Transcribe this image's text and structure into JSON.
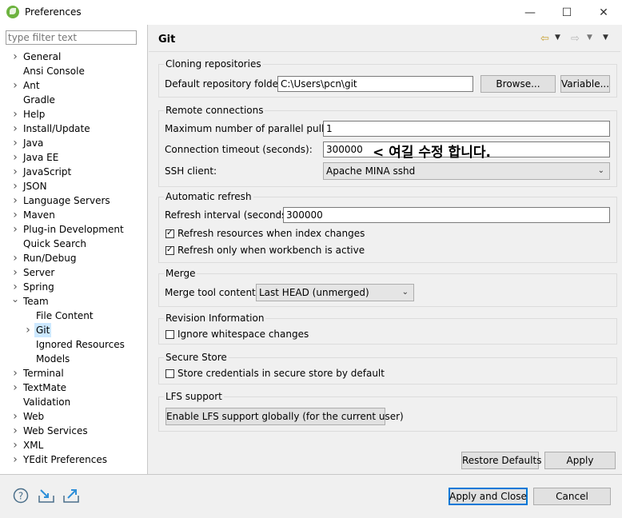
{
  "window": {
    "title": "Preferences",
    "controls": [
      "—",
      "☐",
      "✕"
    ]
  },
  "filter": {
    "placeholder": "type filter text"
  },
  "tree": [
    {
      "label": "General",
      "expander": "collapsed"
    },
    {
      "label": "Ansi Console",
      "expander": "none"
    },
    {
      "label": "Ant",
      "expander": "collapsed"
    },
    {
      "label": "Gradle",
      "expander": "none"
    },
    {
      "label": "Help",
      "expander": "collapsed"
    },
    {
      "label": "Install/Update",
      "expander": "collapsed"
    },
    {
      "label": "Java",
      "expander": "collapsed"
    },
    {
      "label": "Java EE",
      "expander": "collapsed"
    },
    {
      "label": "JavaScript",
      "expander": "collapsed"
    },
    {
      "label": "JSON",
      "expander": "collapsed"
    },
    {
      "label": "Language Servers",
      "expander": "collapsed"
    },
    {
      "label": "Maven",
      "expander": "collapsed"
    },
    {
      "label": "Plug-in Development",
      "expander": "collapsed"
    },
    {
      "label": "Quick Search",
      "expander": "none"
    },
    {
      "label": "Run/Debug",
      "expander": "collapsed"
    },
    {
      "label": "Server",
      "expander": "collapsed"
    },
    {
      "label": "Spring",
      "expander": "collapsed"
    },
    {
      "label": "Team",
      "expander": "expanded"
    },
    {
      "label": "File Content",
      "expander": "none",
      "level": 1
    },
    {
      "label": "Git",
      "expander": "collapsed",
      "level": 1,
      "selected": true
    },
    {
      "label": "Ignored Resources",
      "expander": "none",
      "level": 1
    },
    {
      "label": "Models",
      "expander": "none",
      "level": 1
    },
    {
      "label": "Terminal",
      "expander": "collapsed"
    },
    {
      "label": "TextMate",
      "expander": "collapsed"
    },
    {
      "label": "Validation",
      "expander": "none"
    },
    {
      "label": "Web",
      "expander": "collapsed"
    },
    {
      "label": "Web Services",
      "expander": "collapsed"
    },
    {
      "label": "XML",
      "expander": "collapsed"
    },
    {
      "label": "YEdit Preferences",
      "expander": "collapsed"
    }
  ],
  "page": {
    "title": "Git"
  },
  "cloning": {
    "title": "Cloning repositories",
    "folder_label": "Default repository folder:",
    "folder_value": "C:\\Users\\pcn\\git",
    "browse": "Browse...",
    "variable": "Variable..."
  },
  "remote": {
    "title": "Remote connections",
    "pulls_label": "Maximum number of parallel pulls:",
    "pulls_value": "1",
    "timeout_label": "Connection timeout (seconds):",
    "timeout_value": "300000",
    "annotation": "< 여길 수정 합니다.",
    "ssh_label": "SSH client:",
    "ssh_value": "Apache MINA sshd"
  },
  "refresh": {
    "title": "Automatic refresh",
    "interval_label": "Refresh interval (seconds):",
    "interval_value": "300000",
    "cb1_label": "Refresh resources when index changes",
    "cb1_checked": true,
    "cb2_label": "Refresh only when workbench is active",
    "cb2_checked": true
  },
  "merge": {
    "title": "Merge",
    "tool_label": "Merge tool content:",
    "tool_value": "Last HEAD (unmerged)"
  },
  "revision": {
    "title": "Revision Information",
    "cb_label": "Ignore whitespace changes",
    "cb_checked": false
  },
  "secure": {
    "title": "Secure Store",
    "cb_label": "Store credentials in secure store by default",
    "cb_checked": false
  },
  "lfs": {
    "title": "LFS support",
    "button": "Enable LFS support globally (for the current user)"
  },
  "page_buttons": {
    "restore": "Restore Defaults",
    "apply": "Apply"
  },
  "footer": {
    "apply_close": "Apply and Close",
    "cancel": "Cancel"
  }
}
